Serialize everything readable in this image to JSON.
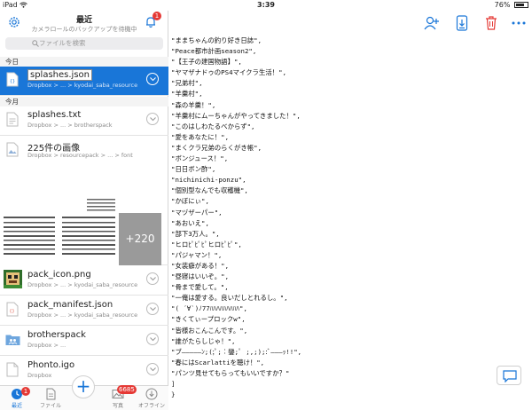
{
  "status_bar": {
    "device": "iPad",
    "wifi_icon": "wifi-icon",
    "time": "3:39",
    "battery": "76%",
    "battery_fraction": 0.76
  },
  "sidebar": {
    "title": "最近",
    "subtitle": "カメラロールのバックアップを待機中",
    "notification_count": "1",
    "search_placeholder": "ファイルを検索",
    "section_today": "今日",
    "section_month": "今月",
    "items": [
      {
        "name": "splashes.json",
        "path": "Dropbox > ... > kyodai_saba_resource",
        "icon": "json-file-icon",
        "selected": true
      },
      {
        "name": "splashes.txt",
        "path": "Dropbox > ... > brotherspack",
        "icon": "text-file-icon"
      },
      {
        "name": "225件の画像",
        "path": "Dropbox > resourcepack > ... > font",
        "icon": "image-icon"
      },
      {
        "name": "pack_icon.png",
        "path": "Dropbox > ... > kyodai_saba_resource",
        "icon": "pack-icon-thumbnail"
      },
      {
        "name": "pack_manifest.json",
        "path": "Dropbox > ... > kyodai_saba_resource",
        "icon": "json-file-icon"
      },
      {
        "name": "brotherspack",
        "path": "Dropbox > ...",
        "icon": "shared-folder-icon"
      },
      {
        "name": "Phonto.igo",
        "path": "Dropbox",
        "icon": "file-icon"
      }
    ],
    "more_images": "+220"
  },
  "tabbar": {
    "tabs": [
      {
        "label": "最近",
        "badge": "1",
        "icon": "clock-icon"
      },
      {
        "label": "ファイル",
        "icon": "files-icon"
      },
      {
        "label": "",
        "icon": "plus-icon"
      },
      {
        "label": "写真",
        "badge": "6685",
        "icon": "photos-icon"
      },
      {
        "label": "オフライン",
        "icon": "offline-icon"
      }
    ]
  },
  "toolbar": {
    "icons": [
      "share-user-icon",
      "export-icon",
      "trash-icon",
      "more-icon"
    ]
  },
  "file_content": [
    "\"ままちゃんの釣り好き日誌\",",
    "\"Peace都市計画season2\",",
    "\"【王子の建国物語】\",",
    "\"ヤマザナドゥのPS4マイクラ生活！\",",
    "\"兄弟村\",",
    "\"羊羹村\",",
    "\"森の羊羹！\",",
    "\"羊羹村にムーちゃんがやってきました！\",",
    "\"このはしわたるべからず\",",
    "\"愛をあなたに！\",",
    "\"まくクラ兄弟のらくがき帳\",",
    "\"ボンジュース！\",",
    "\"日日ボン酢\",",
    "\"nichinichi-ponzu\",",
    "\"個別型なんでも収穫機\",",
    "\"かぼにぃ\",",
    "\"マヅザーパー\",",
    "\"あおいえ\",",
    "\"部下3万人。\",",
    "\"ヒロﾋﾟﾋﾟﾋﾟヒロﾋﾟﾋﾟ\",",
    "\"パジャマン！\",",
    "\"女装癖がある！\",",
    "\"昼寝はいいぞ。\",",
    "\"骨まで愛して。\",",
    "\"一俺は愛する。良いだしとれるし。\",",
    "\"( ´∀`)ﾉ77ﾊﾊﾊﾊﾊﾊﾊﾊﾊ\",",
    "\"きくてぃープロックw\",",
    "\"皆様おこんこんです。\",",
    "\"誰がたらしじゃ！\",",
    "\"ブ―――――ﾝ;(;ﾟ;︰鑾;ﾟ ;,;);:ﾞ―――ｯ!!\",",
    "\"春にはScarlattiを聴け！\",",
    "\"パンツ見せてもらってもいいですか？\"",
    "]",
    "}"
  ],
  "colors": {
    "accent": "#1976d8",
    "danger": "#e53935"
  }
}
